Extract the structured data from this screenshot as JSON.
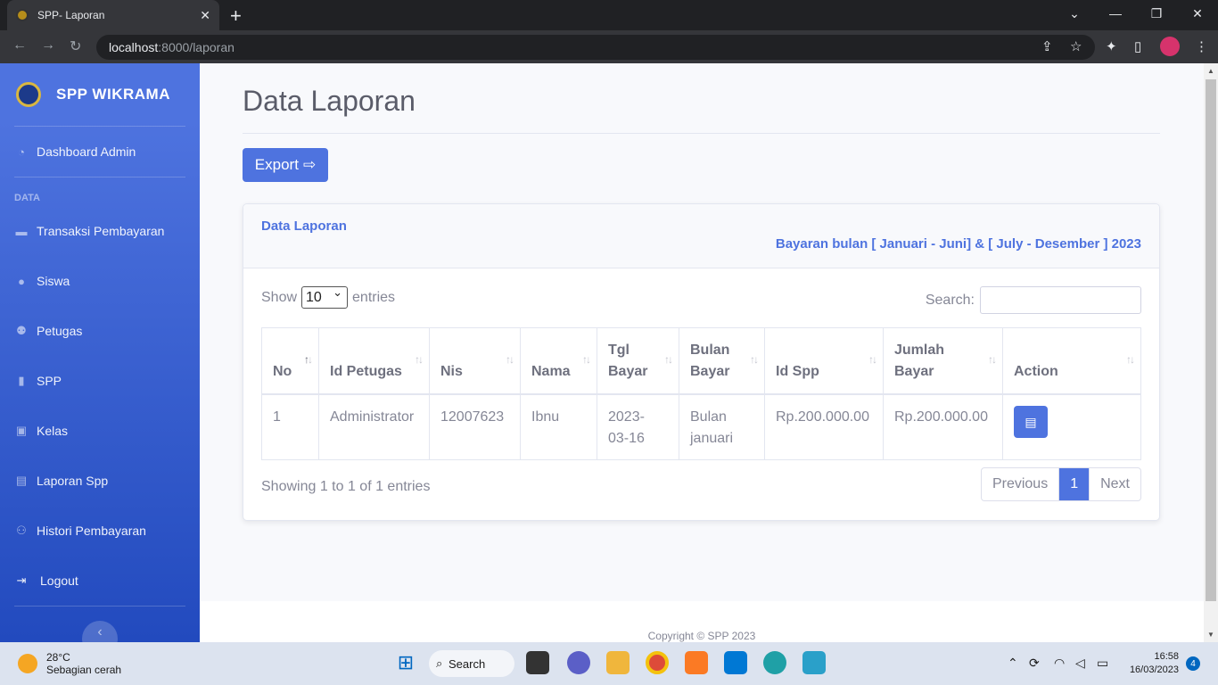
{
  "browser": {
    "tab_title": "SPP- Laporan",
    "url_host": "localhost",
    "url_path": ":8000/laporan"
  },
  "sidebar": {
    "brand": "SPP WIKRAMA",
    "items": [
      {
        "label": "Dashboard Admin",
        "icon": "dashboard-icon"
      },
      {
        "label": "Transaksi Pembayaran",
        "icon": "money-icon"
      },
      {
        "label": "Siswa",
        "icon": "user-icon"
      },
      {
        "label": "Petugas",
        "icon": "users-icon"
      },
      {
        "label": "SPP",
        "icon": "file-icon"
      },
      {
        "label": "Kelas",
        "icon": "h-square-icon"
      },
      {
        "label": "Laporan Spp",
        "icon": "book-icon"
      },
      {
        "label": "Histori Pembayaran",
        "icon": "history-icon"
      },
      {
        "label": "Logout",
        "icon": "logout-icon"
      }
    ],
    "heading": "DATA"
  },
  "page": {
    "title": "Data Laporan",
    "export_label": "Export"
  },
  "card": {
    "title": "Data Laporan",
    "subtitle": "Bayaran bulan [ Januari - Juni] & [ July - Desember ] 2023"
  },
  "table_controls": {
    "show_label": "Show",
    "entries_value": "10",
    "entries_label": "entries",
    "search_label": "Search:"
  },
  "table": {
    "headers": [
      "No",
      "Id Petugas",
      "Nis",
      "Nama",
      "Tgl Bayar",
      "Bulan Bayar",
      "Id Spp",
      "Jumlah Bayar",
      "Action"
    ],
    "rows": [
      {
        "no": "1",
        "id_petugas": "Administrator",
        "nis": "12007623",
        "nama": "Ibnu",
        "tgl_bayar": "2023-03-16",
        "bulan_bayar": "Bulan januari",
        "id_spp": "Rp.200.000.00",
        "jumlah_bayar": "Rp.200.000.00"
      }
    ]
  },
  "pagination": {
    "info": "Showing 1 to 1 of 1 entries",
    "previous": "Previous",
    "current": "1",
    "next": "Next"
  },
  "footer": {
    "copyright": "Copyright © SPP 2023"
  },
  "taskbar": {
    "temperature": "28°C",
    "weather": "Sebagian cerah",
    "search_label": "Search",
    "time": "16:58",
    "date": "16/03/2023",
    "notification_count": "4"
  }
}
